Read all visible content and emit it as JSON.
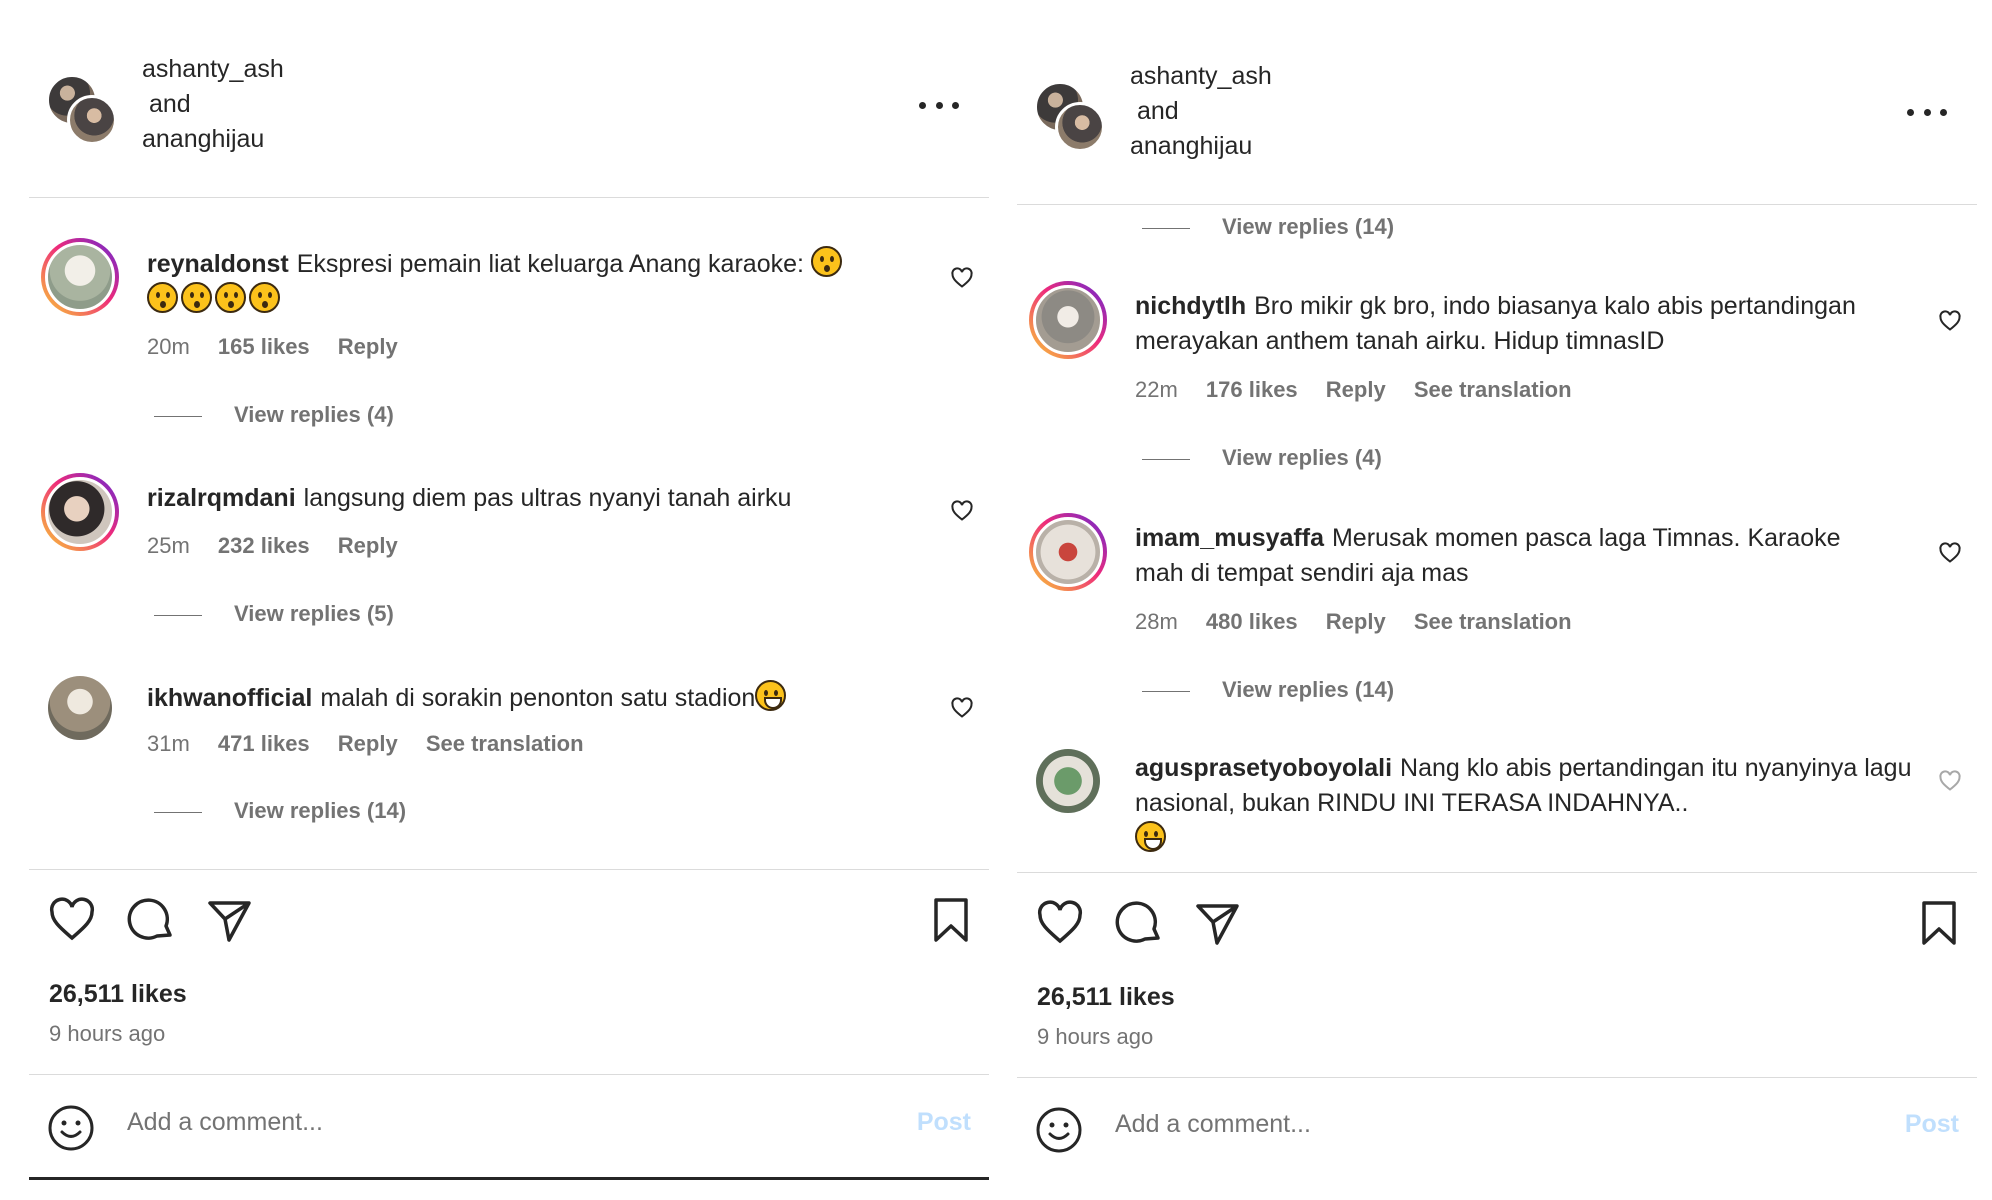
{
  "panels": [
    {
      "owner1": "ashanty_ash",
      "and": "and",
      "owner2": "ananghijau",
      "comments": [
        {
          "user": "reynaldonst",
          "text": "Ekspresi pemain liat keluarga Anang karaoke:",
          "time": "20m",
          "likes": "165 likes",
          "reply": "Reply",
          "view_replies": "View replies (4)"
        },
        {
          "user": "rizalrqmdani",
          "text": "langsung diem pas ultras nyanyi tanah airku",
          "time": "25m",
          "likes": "232 likes",
          "reply": "Reply",
          "view_replies": "View replies (5)"
        },
        {
          "user": "ikhwanofficial",
          "text": "malah di sorakin penonton satu stadion",
          "time": "31m",
          "likes": "471 likes",
          "reply": "Reply",
          "see_translation": "See translation",
          "view_replies": "View replies (14)"
        }
      ],
      "total_likes": "26,511 likes",
      "time_ago": "9 hours ago",
      "add_comment_placeholder": "Add a comment...",
      "post_label": "Post"
    },
    {
      "owner1": "ashanty_ash",
      "and": "and",
      "owner2": "ananghijau",
      "top_view_replies": "View replies (14)",
      "comments": [
        {
          "user": "nichdytlh",
          "text": "Bro mikir gk bro, indo biasanya kalo abis pertandingan merayakan anthem tanah airku. Hidup timnasID",
          "time": "22m",
          "likes": "176 likes",
          "reply": "Reply",
          "see_translation": "See translation",
          "view_replies": "View replies (4)"
        },
        {
          "user": "imam_musyaffa",
          "text": "Merusak momen pasca laga Timnas. Karaoke mah di tempat sendiri aja mas",
          "time": "28m",
          "likes": "480 likes",
          "reply": "Reply",
          "see_translation": "See translation",
          "view_replies": "View replies (14)"
        },
        {
          "user": "agusprasetyoboyolali",
          "text": "Nang klo abis pertandingan itu nyanyinya lagu nasional, bukan RINDU INI TERASA INDAHNYA.."
        }
      ],
      "total_likes": "26,511 likes",
      "time_ago": "9 hours ago",
      "add_comment_placeholder": "Add a comment...",
      "post_label": "Post"
    }
  ],
  "icons": {
    "more": "more-options-icon",
    "heart": "heart-icon",
    "comment": "comment-icon",
    "share": "share-icon",
    "save": "bookmark-icon",
    "emoji": "emoji-icon"
  },
  "colors": {
    "text": "#262626",
    "secondary": "#737373",
    "divider": "#dbdbdb",
    "post_disabled": "#c0dffd"
  }
}
